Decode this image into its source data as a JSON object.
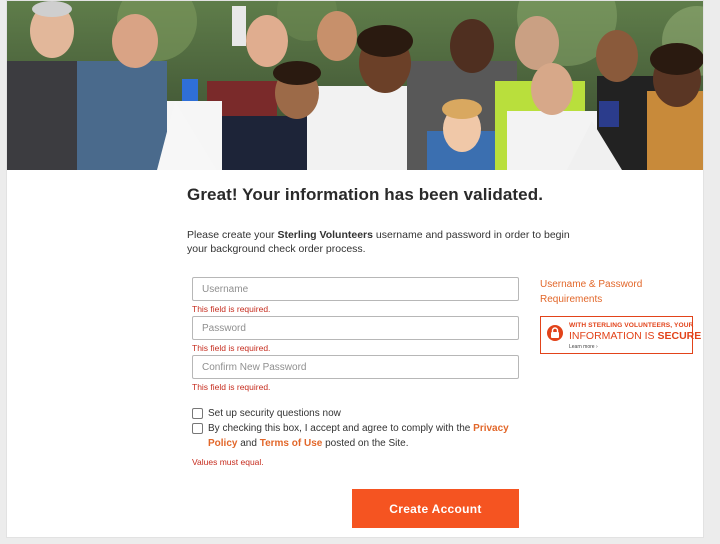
{
  "hero": {
    "image": "group-of-volunteers-photo"
  },
  "headline": "Great! Your information has been validated.",
  "intro": {
    "before": "Please create your ",
    "brand": "Sterling Volunteers",
    "after": " username and password in order to begin your background check order process."
  },
  "form": {
    "username": {
      "placeholder": "Username",
      "value": "",
      "error": "This field is required."
    },
    "password": {
      "placeholder": "Password",
      "value": "",
      "error": "This field is required."
    },
    "confirm_password": {
      "placeholder": "Confirm New Password",
      "value": "",
      "error": "This field is required."
    }
  },
  "requirements_link": "Username & Password Requirements",
  "secure_badge": {
    "line1": "WITH STERLING VOLUNTEERS, YOUR",
    "line2_prefix": "INFORMATION IS ",
    "line2_emph": "SECURE",
    "more": "Learn more ›",
    "icon": "lock-icon",
    "color": "#e2431a"
  },
  "checkboxes": {
    "security_questions": {
      "label": "Set up security questions now",
      "checked": false
    },
    "terms": {
      "before": "By checking this box, I accept and agree to comply with the ",
      "privacy_link": "Privacy Policy",
      "middle": " and ",
      "terms_link": "Terms of Use",
      "after": " posted on the Site.",
      "checked": false
    }
  },
  "values_error": "Values must equal.",
  "submit_label": "Create Account",
  "colors": {
    "accent": "#f55421",
    "link": "#e2672a",
    "error": "#c62d1f"
  }
}
